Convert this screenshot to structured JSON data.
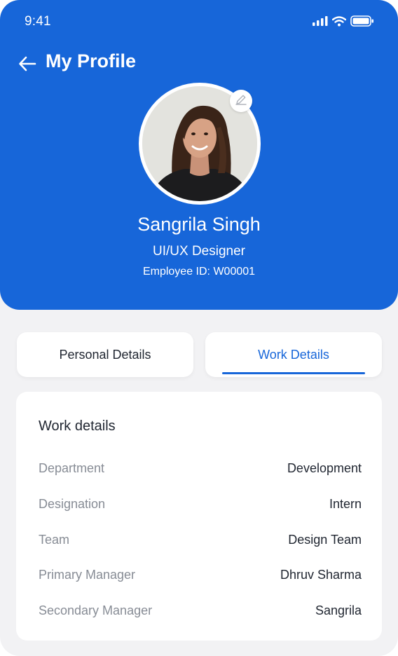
{
  "status_bar": {
    "time": "9:41",
    "icons": [
      "signal-icon",
      "wifi-icon",
      "battery-icon"
    ]
  },
  "header": {
    "title": "My Profile",
    "back_icon": "arrow-left-icon",
    "edit_icon": "pencil-icon"
  },
  "profile": {
    "name": "Sangrila Singh",
    "role": "UI/UX Designer",
    "employee_id": "Employee ID: W00001"
  },
  "tabs": [
    {
      "label": "Personal Details",
      "active": false
    },
    {
      "label": "Work Details",
      "active": true
    }
  ],
  "work_details": {
    "title": "Work details",
    "rows": [
      {
        "label": "Department",
        "value": "Development"
      },
      {
        "label": "Designation",
        "value": "Intern"
      },
      {
        "label": "Team",
        "value": "Design Team"
      },
      {
        "label": "Primary Manager",
        "value": "Dhruv Sharma"
      },
      {
        "label": "Secondary Manager",
        "value": "Sangrila"
      }
    ]
  },
  "colors": {
    "primary": "#1766d9",
    "background": "#f2f2f4",
    "label_gray": "#878c95",
    "text_dark": "#1f2530"
  }
}
